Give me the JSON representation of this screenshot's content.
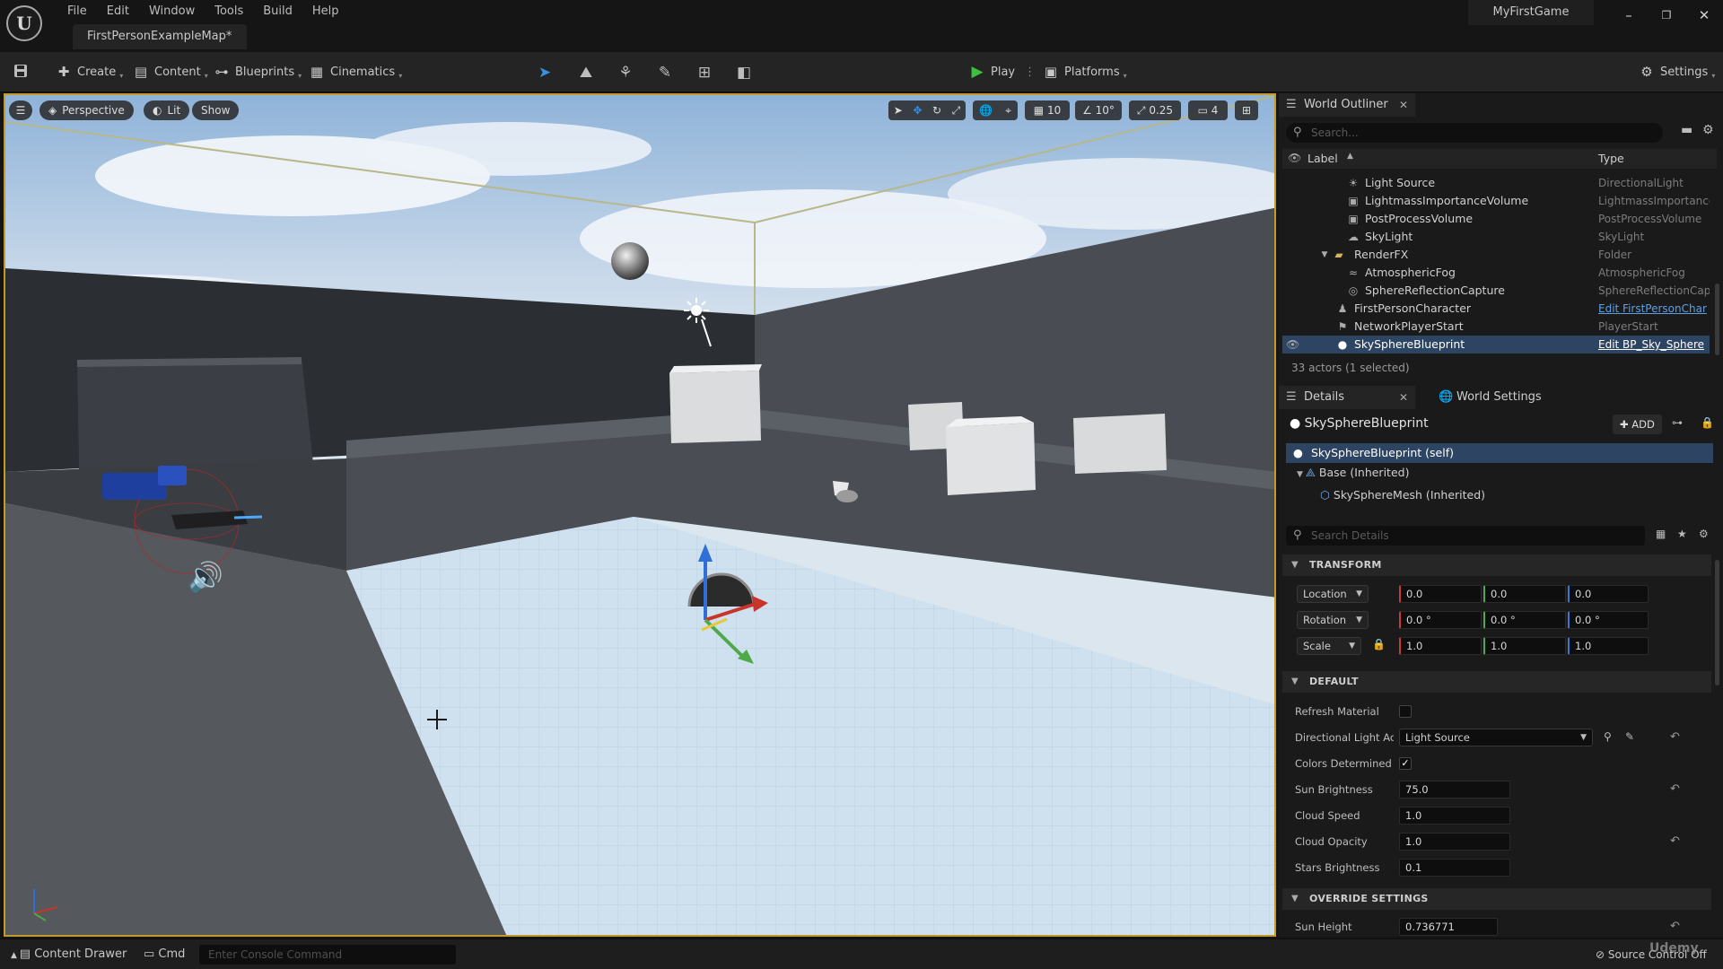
{
  "app": {
    "logo_letter": "U",
    "menu": [
      "File",
      "Edit",
      "Window",
      "Tools",
      "Build",
      "Help"
    ],
    "map_tab": "FirstPersonExampleMap*",
    "project_name": "MyFirstGame",
    "window_controls": {
      "minimize": "–",
      "maximize": "❐",
      "close": "✕"
    }
  },
  "toolbar": {
    "create": "Create",
    "content": "Content",
    "blueprints": "Blueprints",
    "cinematics": "Cinematics",
    "play": "Play",
    "platforms": "Platforms",
    "settings": "Settings"
  },
  "viewport": {
    "perspective": "Perspective",
    "lit": "Lit",
    "show": "Show",
    "grid_snap": "10",
    "rotation_snap": "10°",
    "scale_snap": "0.25",
    "camera_speed": "4",
    "frame_color": "#c49a2a"
  },
  "outliner": {
    "tab": "World Outliner",
    "search_placeholder": "Search...",
    "col_label": "Label",
    "col_type": "Type",
    "rows": [
      {
        "label": "Light Source",
        "type": "DirectionalLight",
        "icon": "light-icon"
      },
      {
        "label": "LightmassImportanceVolume",
        "type": "LightmassImportanceVolume",
        "icon": "volume-icon"
      },
      {
        "label": "PostProcessVolume",
        "type": "PostProcessVolume",
        "icon": "volume-icon"
      },
      {
        "label": "SkyLight",
        "type": "SkyLight",
        "icon": "skylight-icon"
      },
      {
        "label": "RenderFX",
        "type": "Folder",
        "icon": "folder-icon"
      },
      {
        "label": "AtmosphericFog",
        "type": "AtmosphericFog",
        "icon": "fog-icon"
      },
      {
        "label": "SphereReflectionCapture",
        "type": "SphereReflectionCapture",
        "icon": "capture-icon"
      },
      {
        "label": "FirstPersonCharacter",
        "type": "Edit FirstPersonChar",
        "icon": "pawn-icon"
      },
      {
        "label": "NetworkPlayerStart",
        "type": "PlayerStart",
        "icon": "player-start-icon"
      },
      {
        "label": "SkySphereBlueprint",
        "type": "Edit BP_Sky_Sphere",
        "icon": "actor-icon"
      }
    ],
    "actor_count": "33 actors (1 selected)"
  },
  "details": {
    "tab": "Details",
    "world_settings_tab": "World Settings",
    "actor_name": "SkySphereBlueprint",
    "add_label": "ADD",
    "components": [
      "SkySphereBlueprint (self)",
      "Base (Inherited)",
      "SkySphereMesh (Inherited)"
    ],
    "search_placeholder": "Search Details",
    "transform_section": "TRANSFORM",
    "location": {
      "label": "Location",
      "x": "0.0",
      "y": "0.0",
      "z": "0.0"
    },
    "rotation": {
      "label": "Rotation",
      "x": "0.0 °",
      "y": "0.0 °",
      "z": "0.0 °"
    },
    "scale": {
      "label": "Scale",
      "x": "1.0",
      "y": "1.0",
      "z": "1.0"
    },
    "default_section": "DEFAULT",
    "refresh_material": {
      "label": "Refresh Material",
      "checked": false
    },
    "directional_light": {
      "label": "Directional Light Act",
      "value": "Light Source"
    },
    "colors_determined": {
      "label": "Colors Determined E",
      "checked": true
    },
    "sun_brightness": {
      "label": "Sun Brightness",
      "value": "75.0"
    },
    "cloud_speed": {
      "label": "Cloud Speed",
      "value": "1.0"
    },
    "cloud_opacity": {
      "label": "Cloud Opacity",
      "value": "1.0"
    },
    "stars_brightness": {
      "label": "Stars Brightness",
      "value": "0.1"
    },
    "override_section": "OVERRIDE SETTINGS",
    "sun_height": {
      "label": "Sun Height",
      "value": "0.736771"
    }
  },
  "statusbar": {
    "content_drawer": "Content Drawer",
    "cmd": "Cmd",
    "console_placeholder": "Enter Console Command",
    "source_control": "Source Control Off",
    "watermark": "Udemy"
  }
}
